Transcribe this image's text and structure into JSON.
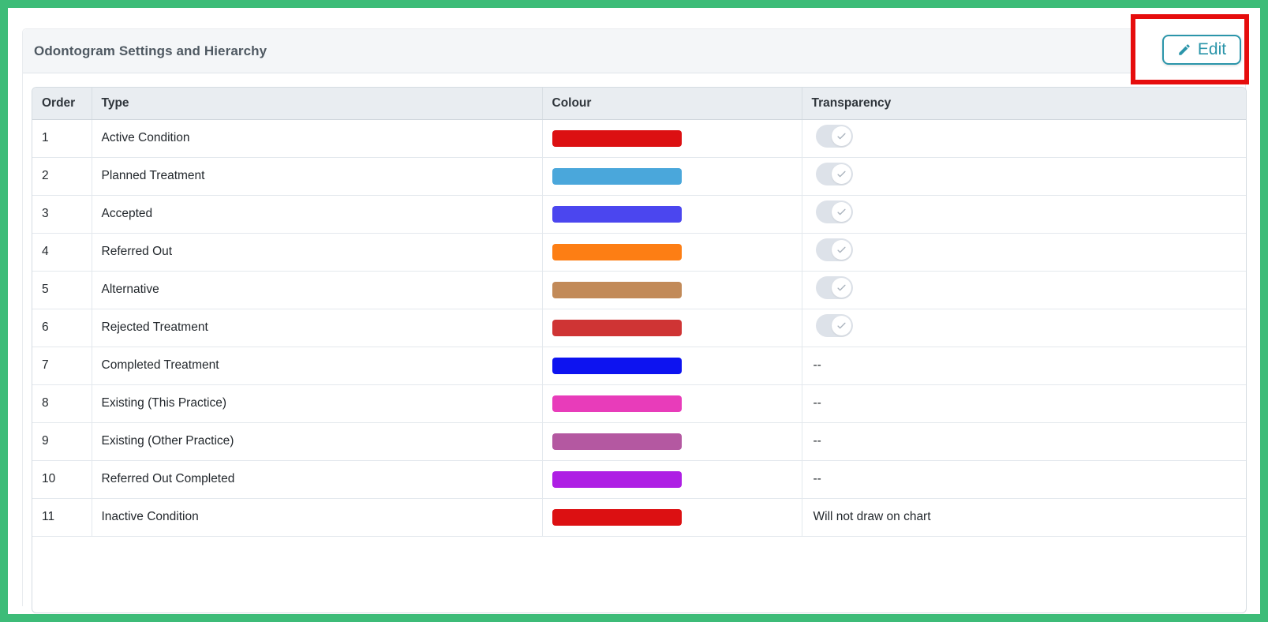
{
  "panel": {
    "title": "Odontogram Settings and Hierarchy",
    "edit_button": {
      "label": "Edit",
      "icon": "pencil-icon"
    }
  },
  "table": {
    "columns": [
      "Order",
      "Type",
      "Colour",
      "Transparency"
    ],
    "rows": [
      {
        "order": "1",
        "type": "Active Condition",
        "colour_hex": "#dc1012",
        "transparency": {
          "control": "toggle",
          "state": "on"
        }
      },
      {
        "order": "2",
        "type": "Planned Treatment",
        "colour_hex": "#4aa7db",
        "transparency": {
          "control": "toggle",
          "state": "on"
        }
      },
      {
        "order": "3",
        "type": "Accepted",
        "colour_hex": "#4b46ef",
        "transparency": {
          "control": "toggle",
          "state": "on"
        }
      },
      {
        "order": "4",
        "type": "Referred Out",
        "colour_hex": "#fd7e14",
        "transparency": {
          "control": "toggle",
          "state": "on"
        }
      },
      {
        "order": "5",
        "type": "Alternative",
        "colour_hex": "#c28a58",
        "transparency": {
          "control": "toggle",
          "state": "on"
        }
      },
      {
        "order": "6",
        "type": "Rejected Treatment",
        "colour_hex": "#cf3434",
        "transparency": {
          "control": "toggle",
          "state": "on"
        }
      },
      {
        "order": "7",
        "type": "Completed Treatment",
        "colour_hex": "#0d13f0",
        "transparency": {
          "control": "text",
          "value": "--"
        }
      },
      {
        "order": "8",
        "type": "Existing (This Practice)",
        "colour_hex": "#e83cba",
        "transparency": {
          "control": "text",
          "value": "--"
        }
      },
      {
        "order": "9",
        "type": "Existing (Other Practice)",
        "colour_hex": "#b458a1",
        "transparency": {
          "control": "text",
          "value": "--"
        }
      },
      {
        "order": "10",
        "type": "Referred Out Completed",
        "colour_hex": "#ae1fe4",
        "transparency": {
          "control": "text",
          "value": "--"
        }
      },
      {
        "order": "11",
        "type": "Inactive Condition",
        "colour_hex": "#dc1012",
        "transparency": {
          "control": "text",
          "value": "Will not draw on chart"
        }
      }
    ]
  },
  "colors": {
    "frame_green": "#3dbc78",
    "annotation_red": "#e60d0d",
    "edit_teal": "#2b95aa"
  }
}
